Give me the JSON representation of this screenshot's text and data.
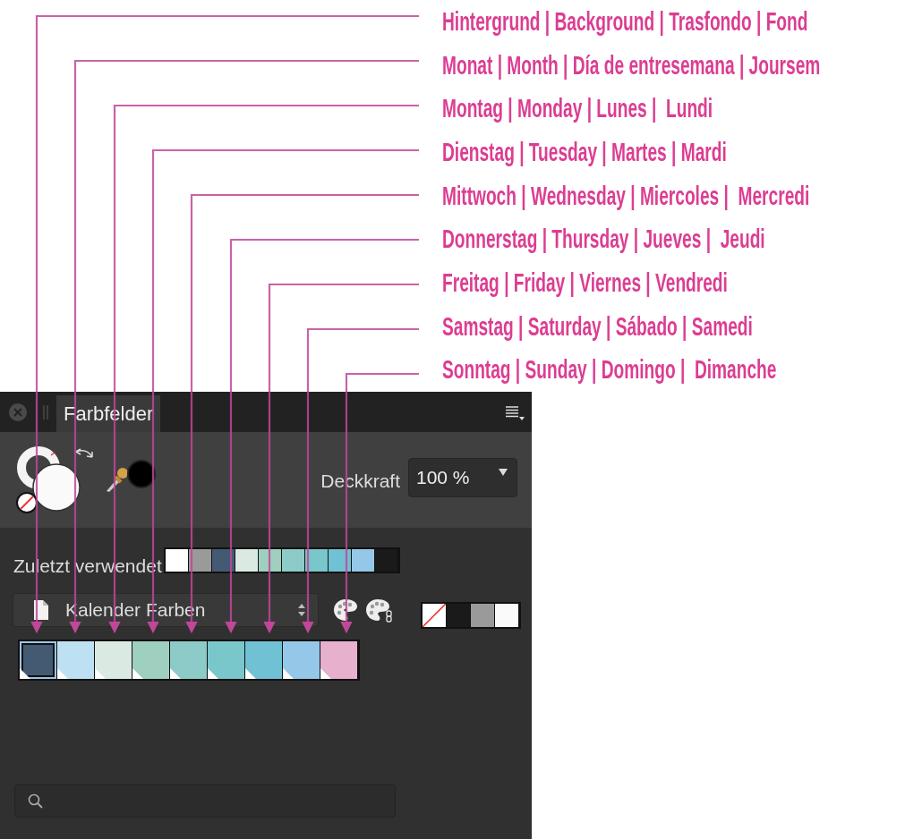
{
  "annotations": [
    "Hintergrund | Background | Trasfondo | Fond",
    "Monat | Month | Día de entresemana | Joursem",
    "Montag | Monday | Lunes |  Lundi",
    "Dienstag | Tuesday | Martes | Mardi",
    "Mittwoch | Wednesday | Miercoles |  Mercredi",
    "Donnerstag | Thursday | Jueves |  Jeudi",
    "Freitag | Friday | Viernes | Vendredi",
    "Samstag | Saturday | Sábado | Samedi",
    "Sonntag | Sunday | Domingo |  Dimanche"
  ],
  "panel": {
    "tab": "Farbfelder",
    "opacity": {
      "label": "Deckkraft",
      "value": "100 %"
    },
    "recent": {
      "label": "Zuletzt verwendet",
      "swatches": [
        {
          "color": "#ffffff"
        },
        {
          "color": "#9a9a9a"
        },
        {
          "color": "#435a72"
        },
        {
          "color": "#dbe9e3"
        },
        {
          "color": "#9fcfbe"
        },
        {
          "color": "#8ccbc7"
        },
        {
          "color": "#79c6cb"
        },
        {
          "color": "#70c1d3"
        },
        {
          "color": "#95c8e8"
        },
        {
          "color": "#1a1a1a"
        }
      ]
    },
    "palette": "Kalender Farben",
    "gray_swatches": [
      {
        "kind": "none"
      },
      {
        "kind": "color",
        "color": "#1a1a1a"
      },
      {
        "kind": "color",
        "color": "#9a9a9a"
      },
      {
        "kind": "color",
        "color": "#fafafa"
      }
    ],
    "swatches": [
      {
        "color": "#435a72",
        "selected": true
      },
      {
        "color": "#bde1f3",
        "selected": false
      },
      {
        "color": "#dbe9e3",
        "selected": false
      },
      {
        "color": "#9fcfbe",
        "selected": false
      },
      {
        "color": "#8ccbc7",
        "selected": false
      },
      {
        "color": "#79c6cb",
        "selected": false
      },
      {
        "color": "#70c1d3",
        "selected": false
      },
      {
        "color": "#95c8e8",
        "selected": false
      },
      {
        "color": "#e7b0cc",
        "selected": false
      }
    ]
  }
}
